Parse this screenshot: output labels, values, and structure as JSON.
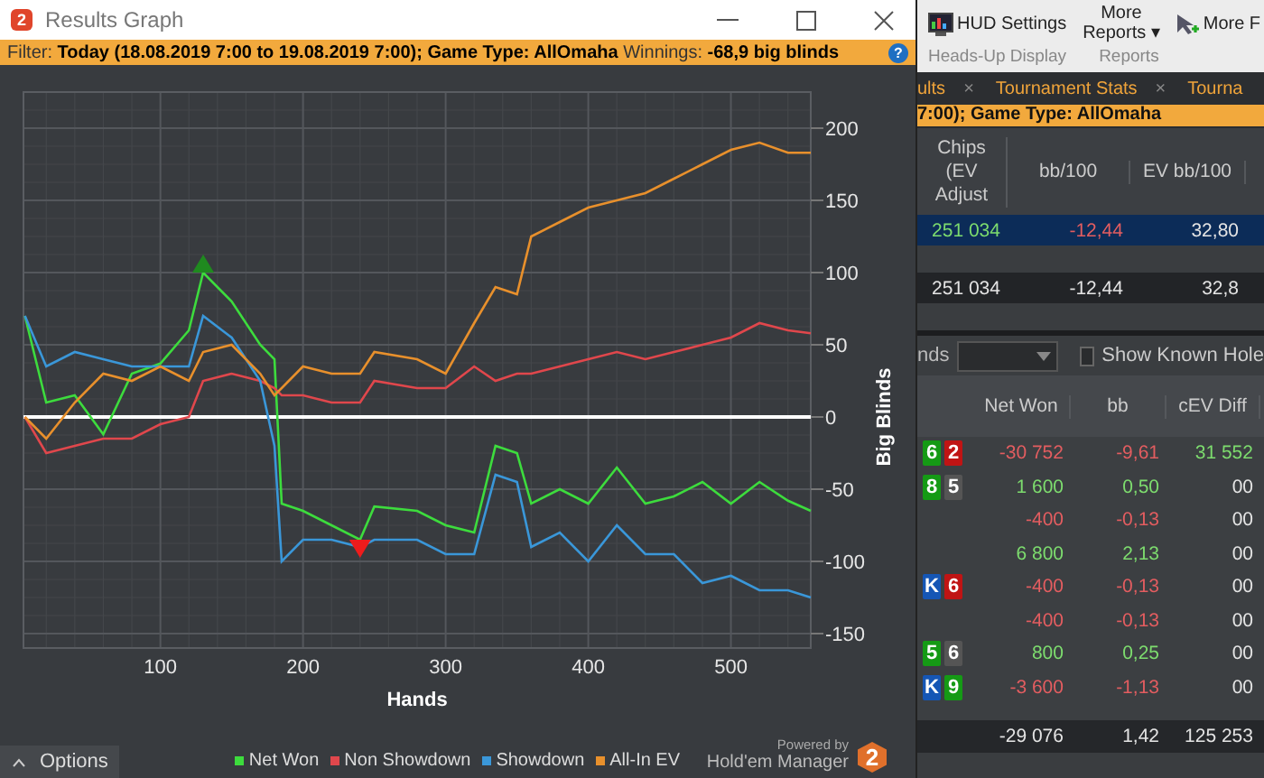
{
  "window": {
    "logo": "2",
    "title": "Results Graph",
    "filter": "Filter: **Today (18.08.2019 7:00 to 19.08.2019 7:00); Game Type: AllOmaha** Winnings: **-68,9 big blinds**",
    "help": "?"
  },
  "chart": {
    "chart_data": {
      "type": "line",
      "xlabel": "Hands",
      "ylabel": "Big Blinds",
      "x": [
        5,
        20,
        40,
        60,
        80,
        100,
        120,
        130,
        150,
        170,
        180,
        185,
        200,
        220,
        240,
        250,
        280,
        300,
        320,
        335,
        350,
        360,
        380,
        400,
        420,
        440,
        460,
        480,
        500,
        520,
        540,
        556
      ],
      "series": [
        {
          "name": "Net Won",
          "color": "#3ddc3d",
          "values": [
            70,
            10,
            15,
            -12,
            30,
            37,
            60,
            100,
            80,
            50,
            40,
            -60,
            -65,
            -75,
            -85,
            -62,
            -65,
            -75,
            -80,
            -20,
            -25,
            -60,
            -50,
            -60,
            -35,
            -60,
            -55,
            -45,
            -60,
            -45,
            -58,
            -65
          ]
        },
        {
          "name": "Non Showdown",
          "color": "#e0474c",
          "values": [
            0,
            -25,
            -20,
            -15,
            -15,
            -5,
            0,
            25,
            30,
            25,
            20,
            15,
            15,
            10,
            10,
            25,
            20,
            20,
            35,
            25,
            30,
            30,
            35,
            40,
            45,
            40,
            45,
            50,
            55,
            65,
            60,
            58
          ]
        },
        {
          "name": "Showdown",
          "color": "#3a97d9",
          "values": [
            70,
            35,
            45,
            40,
            35,
            35,
            35,
            70,
            55,
            25,
            -20,
            -100,
            -85,
            -85,
            -90,
            -85,
            -85,
            -95,
            -95,
            -40,
            -45,
            -90,
            -80,
            -100,
            -75,
            -95,
            -95,
            -115,
            -110,
            -120,
            -120,
            -125
          ]
        },
        {
          "name": "All-In EV",
          "color": "#e8902c",
          "values": [
            0,
            -15,
            10,
            30,
            25,
            35,
            25,
            45,
            50,
            30,
            15,
            20,
            35,
            30,
            30,
            45,
            40,
            30,
            65,
            90,
            85,
            125,
            135,
            145,
            150,
            155,
            165,
            175,
            185,
            190,
            183,
            183
          ]
        }
      ],
      "grid": true,
      "xlim": [
        4,
        556
      ],
      "ylim": [
        -160,
        225
      ],
      "xticks": [
        100,
        200,
        300,
        400,
        500
      ],
      "yticks": [
        -150,
        -100,
        -50,
        0,
        50,
        100,
        150,
        200
      ]
    }
  },
  "footer": {
    "options": "Options",
    "powered_by": "Powered by",
    "product": "Hold'em Manager",
    "logo": "2"
  },
  "ribbon": {
    "buttons": [
      {
        "kind": "hud",
        "label": "HUD Settings"
      },
      {
        "kind": "menu",
        "label": "More",
        "label_2": "Reports",
        "caret": "▾"
      },
      {
        "kind": "more",
        "label": "More F"
      }
    ],
    "groups": [
      "Heads-Up Display",
      "Reports"
    ]
  },
  "tabs": [
    {
      "label": "ults",
      "close": "×",
      "selected": false
    },
    {
      "label": "Tournament Stats",
      "close": "×",
      "selected": false
    },
    {
      "label": "Tourna",
      "selected": false
    }
  ],
  "report_filter": "7:00); Game Type: AllOmaha",
  "summary": {
    "columns": [
      "Chips (EV Adjust",
      "bb/100",
      "EV bb/100"
    ],
    "rows": [
      {
        "selected": true,
        "cells": [
          {
            "text": "251 034",
            "color": "#7ddc6e"
          },
          {
            "text": "-12,44",
            "color": "#e35d60"
          },
          {
            "text": "32,80",
            "color": "#e4e4e4"
          }
        ]
      },
      {
        "selected": false,
        "cells": [
          {
            "text": "251 034",
            "color": "#e4e4e4"
          },
          {
            "text": "-12,44",
            "color": "#e4e4e4"
          },
          {
            "text": "32,8",
            "color": "#e4e4e4"
          }
        ]
      }
    ]
  },
  "hands": {
    "label": "nds",
    "show_known": {
      "label": "Show Known Hole",
      "checked": false
    },
    "columns": [
      "Net Won",
      "bb",
      "cEV Diff"
    ],
    "rows": [
      {
        "cards": [
          {
            "rank": "6",
            "color": "#159a15"
          },
          {
            "rank": "2",
            "color": "#c01414"
          }
        ],
        "cells": [
          {
            "text": "-30 752",
            "color": "#e35d60"
          },
          {
            "text": "-9,61",
            "color": "#e35d60"
          },
          {
            "text": "31 552",
            "color": "#7ddc6e"
          }
        ]
      },
      {
        "cards": [
          {
            "rank": "8",
            "color": "#159a15"
          },
          {
            "rank": "5",
            "color": "#555555"
          }
        ],
        "cells": [
          {
            "text": "1 600",
            "color": "#7ddc6e"
          },
          {
            "text": "0,50",
            "color": "#7ddc6e"
          },
          {
            "text": "00",
            "color": "#e4e4e4"
          }
        ]
      },
      {
        "cards": [],
        "cells": [
          {
            "text": "-400",
            "color": "#e35d60"
          },
          {
            "text": "-0,13",
            "color": "#e35d60"
          },
          {
            "text": "00",
            "color": "#e4e4e4"
          }
        ]
      },
      {
        "cards": [],
        "cells": [
          {
            "text": "6 800",
            "color": "#7ddc6e"
          },
          {
            "text": "2,13",
            "color": "#7ddc6e"
          },
          {
            "text": "00",
            "color": "#e4e4e4"
          }
        ]
      },
      {
        "cards": [
          {
            "rank": "K",
            "color": "#1556b5"
          },
          {
            "rank": "6",
            "color": "#c01414"
          }
        ],
        "cells": [
          {
            "text": "-400",
            "color": "#e35d60"
          },
          {
            "text": "-0,13",
            "color": "#e35d60"
          },
          {
            "text": "00",
            "color": "#e4e4e4"
          }
        ]
      },
      {
        "cards": [],
        "cells": [
          {
            "text": "-400",
            "color": "#e35d60"
          },
          {
            "text": "-0,13",
            "color": "#e35d60"
          },
          {
            "text": "00",
            "color": "#e4e4e4"
          }
        ]
      },
      {
        "cards": [
          {
            "rank": "5",
            "color": "#159a15"
          },
          {
            "rank": "6",
            "color": "#555555"
          }
        ],
        "cells": [
          {
            "text": "800",
            "color": "#7ddc6e"
          },
          {
            "text": "0,25",
            "color": "#7ddc6e"
          },
          {
            "text": "00",
            "color": "#e4e4e4"
          }
        ]
      },
      {
        "cards": [
          {
            "rank": "K",
            "color": "#1556b5"
          },
          {
            "rank": "9",
            "color": "#159a15"
          }
        ],
        "cells": [
          {
            "text": "-3 600",
            "color": "#e35d60"
          },
          {
            "text": "-1,13",
            "color": "#e35d60"
          },
          {
            "text": "00",
            "color": "#e4e4e4"
          }
        ]
      }
    ],
    "totals": [
      "-29 076",
      "1,42",
      "125 253"
    ]
  }
}
